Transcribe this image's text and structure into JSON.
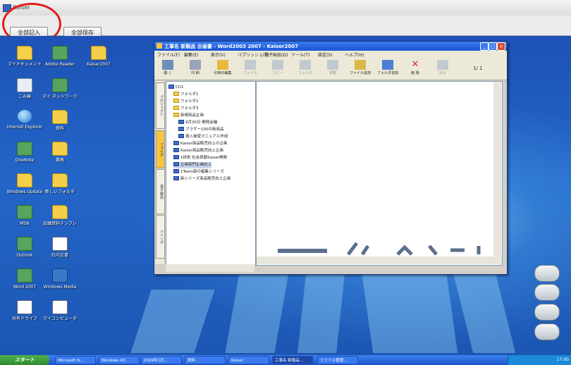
{
  "outer_window": {
    "title": "Kaiser",
    "toolbar": {
      "button_1": "全部記入",
      "button_2": "全部保存"
    }
  },
  "desktop": {
    "icons": [
      {
        "label": "マイドキュメント",
        "kind": "folder"
      },
      {
        "label": "Adobe Reader",
        "kind": "app"
      },
      {
        "label": "Kaiser2007",
        "kind": "folder"
      },
      {
        "label": "ごみ箱",
        "kind": "recycle"
      },
      {
        "label": "マイ ネットワーク",
        "kind": "app"
      },
      {
        "label": "Internet Explorer",
        "kind": "globe"
      },
      {
        "label": "資料",
        "kind": "folder"
      },
      {
        "label": "OneNote",
        "kind": "app"
      },
      {
        "label": "業務",
        "kind": "folder"
      },
      {
        "label": "Windows Update",
        "kind": "folder"
      },
      {
        "label": "新しいフォルダ",
        "kind": "folder"
      },
      {
        "label": "MSN",
        "kind": "app"
      },
      {
        "label": "会議資料テンプレ",
        "kind": "folder"
      },
      {
        "label": "Outlook",
        "kind": "app"
      },
      {
        "label": "社内文書",
        "kind": "doc"
      },
      {
        "label": "Word 2007",
        "kind": "app"
      },
      {
        "label": "Windows Media",
        "kind": "net"
      },
      {
        "label": "共有ドライブ",
        "kind": "doc"
      },
      {
        "label": "マイコンピュータ",
        "kind": "doc"
      }
    ]
  },
  "app_window": {
    "title": "工事名 新製品 企画書 - Word2003 2007 - Kaiser2007",
    "menu": [
      "ファイル(F)",
      "編集(E)",
      "表示(V)",
      "パブリッシュ(P)",
      "電子納品(D)",
      "ツール(T)",
      "設定(S)",
      "ヘルプ(H)"
    ],
    "toolbar": [
      {
        "label": "開 く",
        "icon": "open-icon",
        "disabled": false
      },
      {
        "label": "印 刷",
        "icon": "print-icon",
        "disabled": false
      },
      {
        "label": "引用の編集",
        "icon": "edit-icon",
        "disabled": false
      },
      {
        "label": "ファイル",
        "icon": "file-icon",
        "disabled": true
      },
      {
        "label": "コピー",
        "icon": "copy-icon",
        "disabled": true
      },
      {
        "label": "フォルダ",
        "icon": "folder-icon",
        "disabled": true
      },
      {
        "label": "移動",
        "icon": "move-icon",
        "disabled": true
      },
      {
        "label": "ファイル追加",
        "icon": "add-file-icon",
        "disabled": false
      },
      {
        "label": "フォルダ追加",
        "icon": "add-folder-icon",
        "disabled": false
      },
      {
        "label": "削 除",
        "icon": "delete-icon",
        "disabled": false
      },
      {
        "label": "戻る",
        "icon": "back-icon",
        "disabled": true
      }
    ],
    "page_indicator": "1/ 1",
    "side_tabs": [
      "プロジェクト",
      "フォルダ",
      "電子納品",
      "バインダ"
    ],
    "tree": [
      {
        "label": "CD1",
        "level": 0,
        "kind": "d"
      },
      {
        "label": "フォルダ1",
        "level": 1,
        "kind": "f"
      },
      {
        "label": "フォルダ2",
        "level": 1,
        "kind": "f"
      },
      {
        "label": "フォルダ3",
        "level": 1,
        "kind": "f"
      },
      {
        "label": "新規商品企画",
        "level": 1,
        "kind": "f"
      },
      {
        "label": "9月30日 開発会議",
        "level": 2,
        "kind": "d"
      },
      {
        "label": "ブラザー100の新商品",
        "level": 2,
        "kind": "d"
      },
      {
        "label": "導入後使マニュアル作成",
        "level": 2,
        "kind": "d"
      },
      {
        "label": "Kaiser商品販売向上の企画",
        "level": 1,
        "kind": "d"
      },
      {
        "label": "Kaiser商品販売向上企画",
        "level": 1,
        "kind": "d"
      },
      {
        "label": "1技術 社会貢献Kaiser開発",
        "level": 1,
        "kind": "d"
      },
      {
        "label": "企画部門企画向上",
        "level": 1,
        "kind": "d",
        "selected": true
      },
      {
        "label": "1Team部の編集シリーズ",
        "level": 1,
        "kind": "d"
      },
      {
        "label": "新シリーズ商品販売向上企画",
        "level": 1,
        "kind": "d"
      }
    ]
  },
  "taskbar": {
    "start": "スタート",
    "tasks": [
      "Microsoft O...",
      "Windows XP...",
      "2009年1月...",
      "資料",
      "Kaiser",
      "工事名 新製品...",
      "ファイル管理..."
    ],
    "active_index": 5,
    "time": "17:00"
  }
}
